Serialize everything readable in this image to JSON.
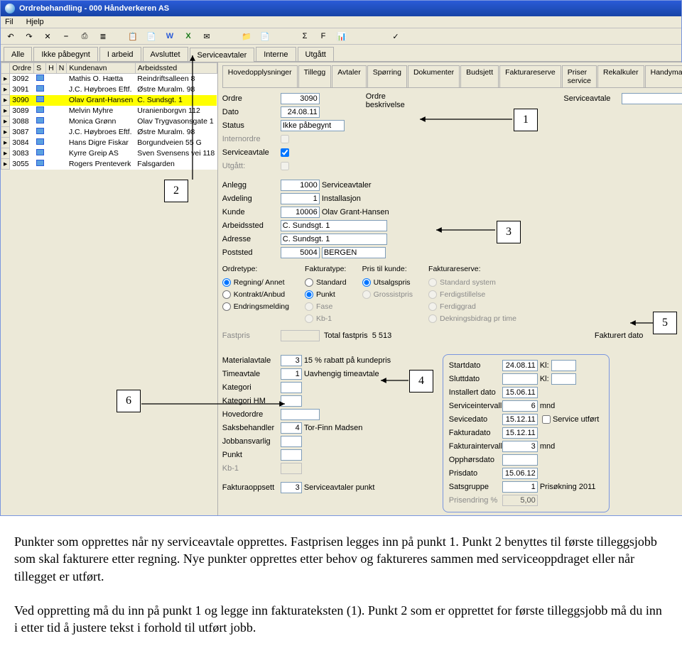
{
  "window": {
    "title": "Ordrebehandling - 000 Håndverkeren AS"
  },
  "menu": {
    "file": "Fil",
    "help": "Hjelp"
  },
  "toolbar_icons": [
    "↶",
    "↷",
    "✕",
    "⎯",
    "⎙",
    "≣",
    "📋",
    "📄",
    "W",
    "X",
    "✉",
    "",
    "📁",
    "📄",
    "",
    "Σ",
    "F",
    "📊",
    "",
    "",
    "✓"
  ],
  "main_tabs": [
    "Alle",
    "Ikke påbegynt",
    "I arbeid",
    "Avsluttet",
    "Serviceavtaler",
    "Interne",
    "Utgått"
  ],
  "main_tabs_active": 4,
  "grid": {
    "headers": [
      "",
      "Ordre",
      "S",
      "H",
      "N",
      "Kundenavn",
      "Arbeidssted"
    ],
    "rows": [
      {
        "o": "3092",
        "k": "Mathis O. Hætta",
        "a": "Reindriftsalleen 8"
      },
      {
        "o": "3091",
        "k": "J.C. Høybroes Eftf.",
        "a": "Østre Muralm. 98"
      },
      {
        "o": "3090",
        "k": "Olav Grant-Hansen",
        "a": "C. Sundsgt. 1",
        "sel": true
      },
      {
        "o": "3089",
        "k": "Melvin Myhre",
        "a": "Uranienborgvn 112"
      },
      {
        "o": "3088",
        "k": "Monica Grønn",
        "a": "Olav Trygvasonsgate 1"
      },
      {
        "o": "3087",
        "k": "J.C. Høybroes Eftf.",
        "a": "Østre Muralm. 98"
      },
      {
        "o": "3084",
        "k": "Hans Digre Fiskar",
        "a": "Borgundveien 55 G"
      },
      {
        "o": "3083",
        "k": "Kyrre Greip AS",
        "a": "Sven Svensens vei 118"
      },
      {
        "o": "3055",
        "k": "Rogers Prenteverk",
        "a": "Falsgarden"
      }
    ]
  },
  "right_tabs": [
    "Hovedopplysninger",
    "Tillegg",
    "Avtaler",
    "Spørring",
    "Dokumenter",
    "Budsjett",
    "Fakturareserve",
    "Priser service",
    "Rekalkuler",
    "Handyman"
  ],
  "fields_top": {
    "ordre_lbl": "Ordre",
    "ordre": "3090",
    "dato_lbl": "Dato",
    "dato": "24.08.11",
    "status_lbl": "Status",
    "status": "Ikke påbegynt",
    "internordre_lbl": "Internordre",
    "serviceavtale_lbl": "Serviceavtale",
    "utgatt_lbl": "Utgått:",
    "ordre_beskr_lbl": "Ordre\nbeskrivelse",
    "serviceavtale_field_lbl": "Serviceavtale"
  },
  "fields_mid": {
    "anlegg_lbl": "Anlegg",
    "anlegg": "1000",
    "anlegg_txt": "Serviceavtaler",
    "avdeling_lbl": "Avdeling",
    "avdeling": "1",
    "avdeling_txt": "Installasjon",
    "kunde_lbl": "Kunde",
    "kunde": "10006",
    "kunde_txt": "Olav Grant-Hansen",
    "arbeidssted_lbl": "Arbeidssted",
    "arbeidssted": "C. Sundsgt. 1",
    "adresse_lbl": "Adresse",
    "adresse": "C. Sundsgt. 1",
    "poststed_lbl": "Poststed",
    "poststed_nr": "5004",
    "poststed_txt": "BERGEN"
  },
  "radio_headers": {
    "a": "Ordretype:",
    "b": "Fakturatype:",
    "c": "Pris til kunde:",
    "d": "Fakturareserve:"
  },
  "ordretype": {
    "a": "Regning/ Annet",
    "b": "Kontrakt/Anbud",
    "c": "Endringsmelding"
  },
  "fakturatype": {
    "a": "Standard",
    "b": "Punkt",
    "c": "Fase",
    "d": "Kb-1"
  },
  "priskunde": {
    "a": "Utsalgspris",
    "b": "Grossistpris"
  },
  "fakturareserve": {
    "a": "Standard system",
    "b": "Ferdigstillelse",
    "c": "Ferdiggrad",
    "d": "Dekningsbidrag pr time"
  },
  "fastpris_row": {
    "fastpris_lbl": "Fastpris",
    "totfastpris_lbl": "Total fastpris",
    "totfastpris": "5 513",
    "fakturert_lbl": "Fakturert dato"
  },
  "fields_low": {
    "materialavtale_lbl": "Materialavtale",
    "materialavtale": "3",
    "materialavtale_txt": "15 % rabatt på kundepris",
    "timeavtale_lbl": "Timeavtale",
    "timeavtale": "1",
    "timeavtale_txt": "Uavhengig timeavtale",
    "kategori_lbl": "Kategori",
    "kategorihm_lbl": "Kategori HM",
    "hovedordre_lbl": "Hovedordre",
    "saksbehandler_lbl": "Saksbehandler",
    "saksbehandler": "4",
    "saksbehandler_txt": "Tor-Finn Madsen",
    "jobbansvarlig_lbl": "Jobbansvarlig",
    "punkt_lbl": "Punkt",
    "kb1_lbl": "Kb-1",
    "fakturaoppsett_lbl": "Fakturaoppsett",
    "fakturaoppsett": "3",
    "fakturaoppsett_txt": "Serviceavtaler punkt"
  },
  "dates": {
    "startdato_lbl": "Startdato",
    "startdato": "24.08.11",
    "kl1_lbl": "Kl:",
    "sluttdato_lbl": "Sluttdato",
    "kl2_lbl": "Kl:",
    "installert_lbl": "Installert dato",
    "installert": "15.06.11",
    "serviceintervall_lbl": "Serviceintervall",
    "serviceintervall": "6",
    "mnd1": "mnd",
    "sevicedato_lbl": "Sevicedato",
    "sevicedato": "15.12.11",
    "serviceutfort_lbl": "Service utført",
    "fakturadato_lbl": "Fakturadato",
    "fakturadato": "15.12.11",
    "fakturaintervall_lbl": "Fakturaintervall",
    "fakturaintervall": "3",
    "mnd2": "mnd",
    "opphorsdato_lbl": "Opphørsdato",
    "prisdato_lbl": "Prisdato",
    "prisdato": "15.06.12",
    "satsgruppe_lbl": "Satsgruppe",
    "satsgruppe": "1",
    "satsgruppe_txt": "Prisøkning 2011",
    "prisendring_lbl": "Prisendring %",
    "prisendring": "5,00"
  },
  "callouts": {
    "1": "1",
    "2": "2",
    "3": "3",
    "4": "4",
    "5": "5",
    "6": "6"
  },
  "below": "Punkter som opprettes når ny serviceavtale opprettes. Fastprisen legges inn på punkt 1. Punkt 2 benyttes til første tilleggsjobb som skal fakturere etter regning. Nye punkter opprettes etter behov og faktureres sammen med serviceoppdraget eller når tillegget er utført.",
  "below2": "Ved oppretting må du inn på punkt 1 og legge inn fakturateksten (1). Punkt 2 som er opprettet for første tilleggsjobb må du inn i etter tid å justere tekst i forhold til utført jobb."
}
